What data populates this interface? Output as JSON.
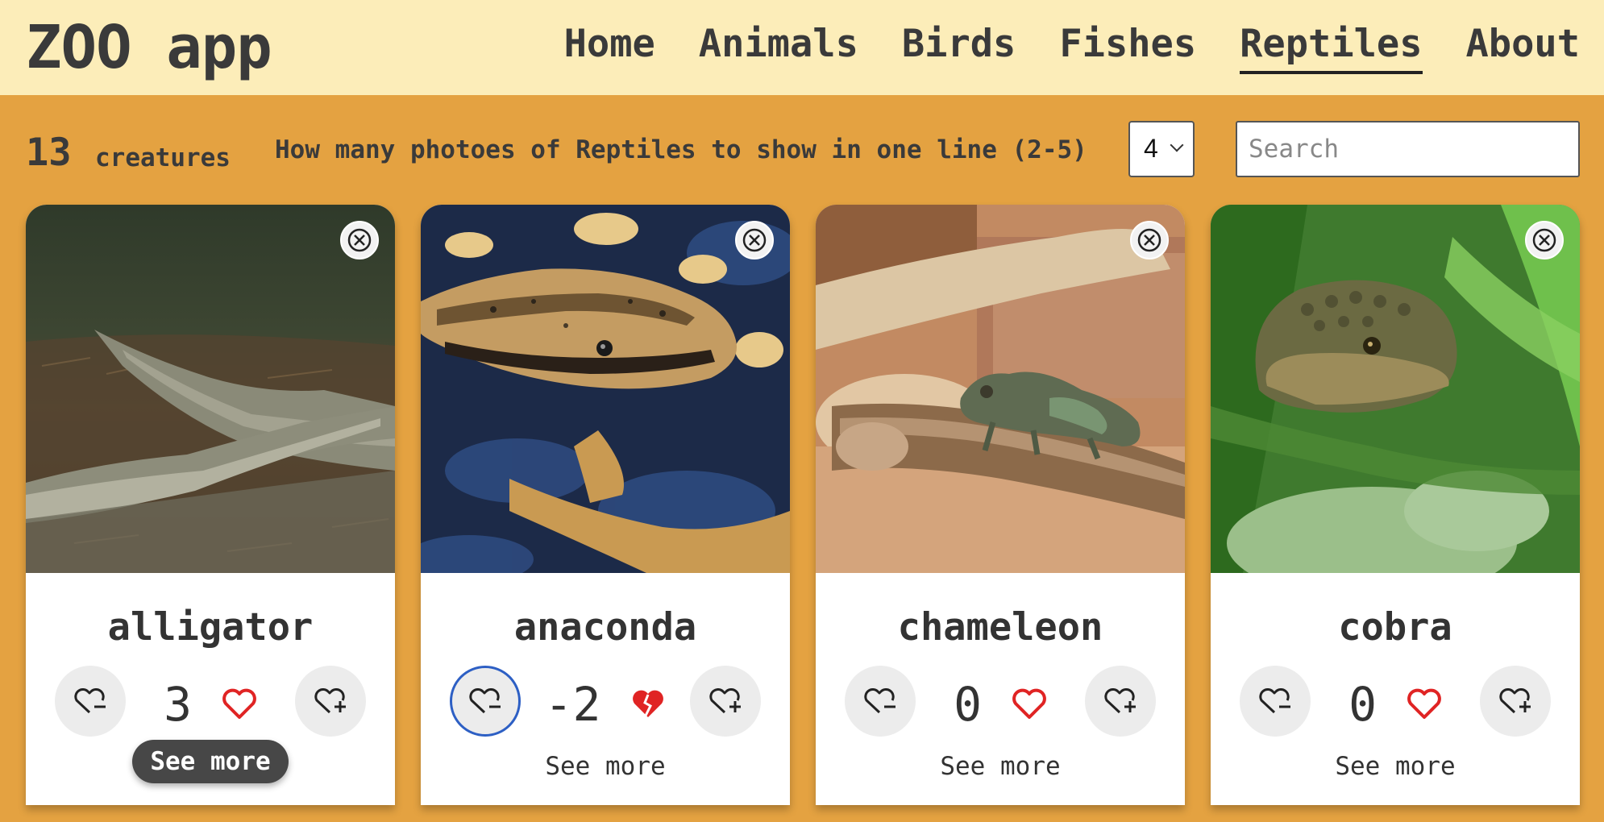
{
  "app": {
    "title": "ZOO app"
  },
  "nav": {
    "items": [
      {
        "label": "Home",
        "active": false
      },
      {
        "label": "Animals",
        "active": false
      },
      {
        "label": "Birds",
        "active": false
      },
      {
        "label": "Fishes",
        "active": false
      },
      {
        "label": "Reptiles",
        "active": true
      },
      {
        "label": "About",
        "active": false
      }
    ]
  },
  "controls": {
    "count": "13",
    "count_label": "creatures",
    "per_line_label": "How many photoes of Reptiles to show in one line (2-5)",
    "per_line_value": "4",
    "search_placeholder": "Search",
    "search_value": ""
  },
  "cards": [
    {
      "name": "alligator",
      "likes": "3",
      "see_more": "See more",
      "heart": "heart-icon"
    },
    {
      "name": "anaconda",
      "likes": "-2",
      "see_more": "See more",
      "heart": "broken-heart-icon"
    },
    {
      "name": "chameleon",
      "likes": "0",
      "see_more": "See more",
      "heart": "heart-icon"
    },
    {
      "name": "cobra",
      "likes": "0",
      "see_more": "See more",
      "heart": "heart-icon"
    }
  ],
  "colors": {
    "header_bg": "#fcedb9",
    "page_bg": "#e4a241",
    "heart": "#e02424",
    "focus_ring": "#2d5fc4"
  }
}
